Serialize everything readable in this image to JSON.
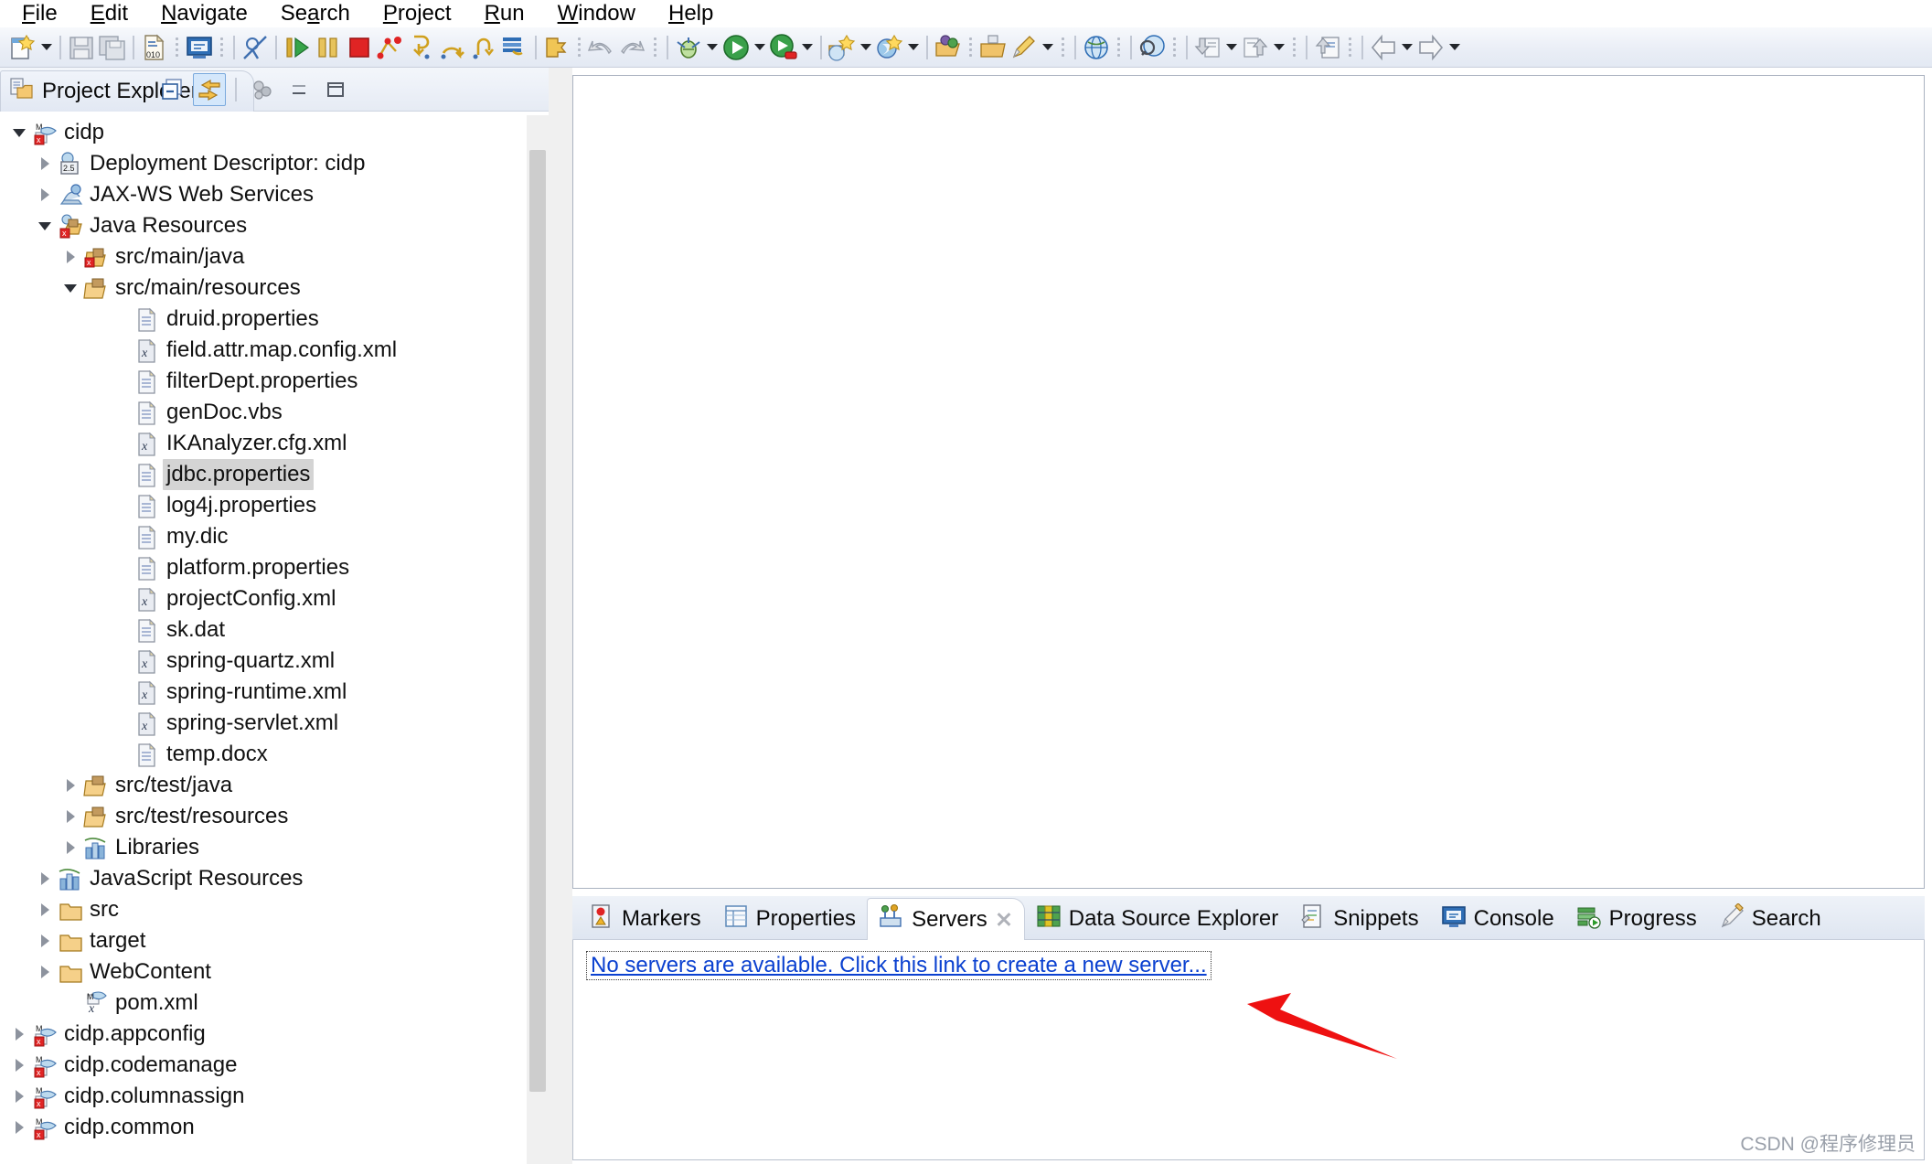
{
  "menu": {
    "items": [
      {
        "label": "File",
        "mnemonic": "F"
      },
      {
        "label": "Edit",
        "mnemonic": "E"
      },
      {
        "label": "Navigate",
        "mnemonic": "N"
      },
      {
        "label": "Search",
        "mnemonic": "a"
      },
      {
        "label": "Project",
        "mnemonic": "P"
      },
      {
        "label": "Run",
        "mnemonic": "R"
      },
      {
        "label": "Window",
        "mnemonic": "W"
      },
      {
        "label": "Help",
        "mnemonic": "H"
      }
    ]
  },
  "toolbar": {
    "buttons": [
      {
        "icon": "new-wizard-icon",
        "dropdown": true
      },
      {
        "icon": "save-icon",
        "dropdown": false
      },
      {
        "icon": "save-all-icon",
        "dropdown": false
      },
      {
        "icon": "new-jsp-file-icon",
        "dropdown": false
      },
      {
        "icon": "open-terminal-icon",
        "dropdown": false
      },
      {
        "icon": "skip-breakpoints-icon",
        "dropdown": false
      },
      {
        "icon": "resume-icon",
        "dropdown": false
      },
      {
        "icon": "suspend-icon",
        "dropdown": false
      },
      {
        "icon": "terminate-icon",
        "dropdown": false
      },
      {
        "icon": "disconnect-icon",
        "dropdown": false
      },
      {
        "icon": "step-into-icon",
        "dropdown": false
      },
      {
        "icon": "step-over-icon",
        "dropdown": false
      },
      {
        "icon": "step-return-icon",
        "dropdown": false
      },
      {
        "icon": "drop-to-frame-icon",
        "dropdown": false
      },
      {
        "icon": "use-step-filters-icon",
        "dropdown": false
      },
      {
        "icon": "undo-icon",
        "dropdown": false
      },
      {
        "icon": "redo-icon",
        "dropdown": false
      },
      {
        "icon": "debug-icon",
        "dropdown": true
      },
      {
        "icon": "run-icon",
        "dropdown": true
      },
      {
        "icon": "run-as-server-icon",
        "dropdown": true
      },
      {
        "icon": "new-java-ee-icon",
        "dropdown": true
      },
      {
        "icon": "new-spring-bean-icon",
        "dropdown": true
      },
      {
        "icon": "open-type-icon",
        "dropdown": false
      },
      {
        "icon": "open-task-icon",
        "dropdown": false
      },
      {
        "icon": "new-annotation-icon",
        "dropdown": true
      },
      {
        "icon": "open-web-browser-icon",
        "dropdown": false
      },
      {
        "icon": "search-globe-icon",
        "dropdown": false
      },
      {
        "icon": "import-icon",
        "dropdown": true
      },
      {
        "icon": "export-icon",
        "dropdown": true
      },
      {
        "icon": "previous-annotation-icon",
        "dropdown": false
      },
      {
        "icon": "back-icon",
        "dropdown": true
      },
      {
        "icon": "forward-icon",
        "dropdown": true
      }
    ]
  },
  "explorer": {
    "tab_title": "Project Explorer",
    "tab_icon": "project-explorer-icon",
    "view_tools": [
      {
        "name": "collapse-all-icon",
        "active": false
      },
      {
        "name": "link-with-editor-icon",
        "active": true
      },
      {
        "name": "view-menu-icon",
        "active": false
      },
      {
        "name": "minimize-icon",
        "active": false
      },
      {
        "name": "maximize-icon",
        "active": false
      }
    ],
    "tree": [
      {
        "label": "cidp",
        "indent": 0,
        "twisty": "down",
        "icon": "maven-web-project-icon",
        "selected": false
      },
      {
        "label": "Deployment Descriptor: cidp",
        "indent": 1,
        "twisty": "right",
        "icon": "deployment-descriptor-icon",
        "selected": false
      },
      {
        "label": "JAX-WS Web Services",
        "indent": 1,
        "twisty": "right",
        "icon": "jaxws-icon",
        "selected": false
      },
      {
        "label": "Java Resources",
        "indent": 1,
        "twisty": "down",
        "icon": "java-resources-error-icon",
        "selected": false
      },
      {
        "label": "src/main/java",
        "indent": 2,
        "twisty": "right",
        "icon": "source-folder-error-icon",
        "selected": false
      },
      {
        "label": "src/main/resources",
        "indent": 2,
        "twisty": "down",
        "icon": "source-folder-icon",
        "selected": false
      },
      {
        "label": "druid.properties",
        "indent": 4,
        "twisty": "none",
        "icon": "file-icon",
        "selected": false
      },
      {
        "label": "field.attr.map.config.xml",
        "indent": 4,
        "twisty": "none",
        "icon": "xml-file-icon",
        "selected": false
      },
      {
        "label": "filterDept.properties",
        "indent": 4,
        "twisty": "none",
        "icon": "file-icon",
        "selected": false
      },
      {
        "label": "genDoc.vbs",
        "indent": 4,
        "twisty": "none",
        "icon": "file-icon",
        "selected": false
      },
      {
        "label": "IKAnalyzer.cfg.xml",
        "indent": 4,
        "twisty": "none",
        "icon": "xml-file-icon",
        "selected": false
      },
      {
        "label": "jdbc.properties",
        "indent": 4,
        "twisty": "none",
        "icon": "file-icon",
        "selected": true
      },
      {
        "label": "log4j.properties",
        "indent": 4,
        "twisty": "none",
        "icon": "file-icon",
        "selected": false
      },
      {
        "label": "my.dic",
        "indent": 4,
        "twisty": "none",
        "icon": "file-icon",
        "selected": false
      },
      {
        "label": "platform.properties",
        "indent": 4,
        "twisty": "none",
        "icon": "file-icon",
        "selected": false
      },
      {
        "label": "projectConfig.xml",
        "indent": 4,
        "twisty": "none",
        "icon": "xml-file-icon",
        "selected": false
      },
      {
        "label": "sk.dat",
        "indent": 4,
        "twisty": "none",
        "icon": "file-icon",
        "selected": false
      },
      {
        "label": "spring-quartz.xml",
        "indent": 4,
        "twisty": "none",
        "icon": "xml-file-icon",
        "selected": false
      },
      {
        "label": "spring-runtime.xml",
        "indent": 4,
        "twisty": "none",
        "icon": "xml-file-icon",
        "selected": false
      },
      {
        "label": "spring-servlet.xml",
        "indent": 4,
        "twisty": "none",
        "icon": "xml-file-icon",
        "selected": false
      },
      {
        "label": "temp.docx",
        "indent": 4,
        "twisty": "none",
        "icon": "file-icon",
        "selected": false
      },
      {
        "label": "src/test/java",
        "indent": 2,
        "twisty": "right",
        "icon": "source-folder-icon",
        "selected": false
      },
      {
        "label": "src/test/resources",
        "indent": 2,
        "twisty": "right",
        "icon": "source-folder-icon",
        "selected": false
      },
      {
        "label": "Libraries",
        "indent": 2,
        "twisty": "right",
        "icon": "libraries-icon",
        "selected": false
      },
      {
        "label": "JavaScript Resources",
        "indent": 1,
        "twisty": "right",
        "icon": "libraries-icon",
        "selected": false
      },
      {
        "label": "src",
        "indent": 1,
        "twisty": "right",
        "icon": "folder-icon",
        "selected": false
      },
      {
        "label": "target",
        "indent": 1,
        "twisty": "right",
        "icon": "folder-icon",
        "selected": false
      },
      {
        "label": "WebContent",
        "indent": 1,
        "twisty": "right",
        "icon": "folder-icon",
        "selected": false
      },
      {
        "label": "pom.xml",
        "indent": 2,
        "twisty": "none",
        "icon": "maven-pom-icon",
        "selected": false
      },
      {
        "label": "cidp.appconfig",
        "indent": 0,
        "twisty": "right",
        "icon": "maven-project-icon",
        "selected": false
      },
      {
        "label": "cidp.codemanage",
        "indent": 0,
        "twisty": "right",
        "icon": "maven-project-icon",
        "selected": false
      },
      {
        "label": "cidp.columnassign",
        "indent": 0,
        "twisty": "right",
        "icon": "maven-project-icon",
        "selected": false
      },
      {
        "label": "cidp.common",
        "indent": 0,
        "twisty": "right",
        "icon": "maven-project-icon",
        "selected": false
      }
    ]
  },
  "bottom_panel": {
    "tabs": [
      {
        "label": "Markers",
        "icon": "markers-icon",
        "active": false,
        "closable": false
      },
      {
        "label": "Properties",
        "icon": "properties-icon",
        "active": false,
        "closable": false
      },
      {
        "label": "Servers",
        "icon": "servers-icon",
        "active": true,
        "closable": true
      },
      {
        "label": "Data Source Explorer",
        "icon": "data-source-explorer-icon",
        "active": false,
        "closable": false
      },
      {
        "label": "Snippets",
        "icon": "snippets-icon",
        "active": false,
        "closable": false
      },
      {
        "label": "Console",
        "icon": "console-icon",
        "active": false,
        "closable": false
      },
      {
        "label": "Progress",
        "icon": "progress-icon",
        "active": false,
        "closable": false
      },
      {
        "label": "Search",
        "icon": "search-icon",
        "active": false,
        "closable": false
      }
    ],
    "servers_link": "No servers are available. Click this link to create a new server..."
  },
  "annotation": {
    "arrow_color": "#ee1111"
  },
  "watermark": "CSDN @程序修理员"
}
